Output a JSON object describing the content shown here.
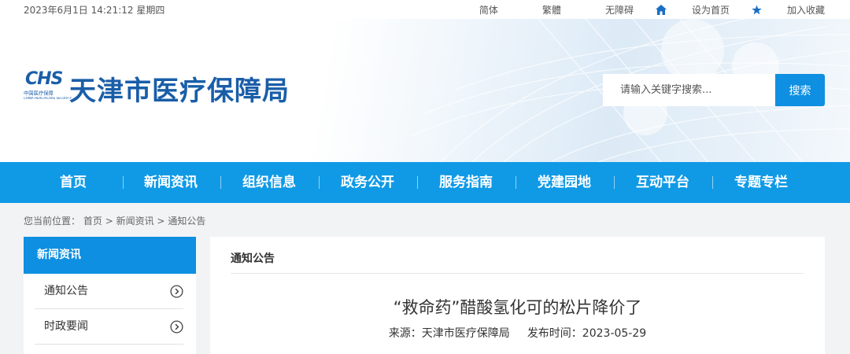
{
  "topbar": {
    "datetime": "2023年6月1日 14:21:12 星期四",
    "links": [
      {
        "label": "简体"
      },
      {
        "label": "繁體"
      },
      {
        "label": "无障碍"
      },
      {
        "label": "设为首页",
        "icon": "home-icon"
      },
      {
        "label": "加入收藏",
        "icon": "star-icon"
      }
    ]
  },
  "header": {
    "logo_abbr": "CHS",
    "logo_sub": "中国医疗保障",
    "logo_sub_en": "CHINA HEALTHCARE SECURITY",
    "site_title": "天津市医疗保障局"
  },
  "search": {
    "placeholder": "请输入关键字搜索...",
    "button_label": "搜索"
  },
  "nav": {
    "items": [
      {
        "label": "首页"
      },
      {
        "label": "新闻资讯"
      },
      {
        "label": "组织信息"
      },
      {
        "label": "政务公开"
      },
      {
        "label": "服务指南"
      },
      {
        "label": "党建园地"
      },
      {
        "label": "互动平台"
      },
      {
        "label": "专题专栏"
      }
    ]
  },
  "breadcrumb": {
    "prefix": "您当前位置：",
    "items": [
      "首页",
      "新闻资讯",
      "通知公告"
    ],
    "separator": ">"
  },
  "sidebar": {
    "heading": "新闻资讯",
    "items": [
      {
        "label": "通知公告"
      },
      {
        "label": "时政要闻"
      }
    ]
  },
  "content": {
    "section_title": "通知公告",
    "article_title": "“救命药”醋酸氢化可的松片降价了",
    "source": "来源：天津市医疗保障局",
    "publish_time": "发布时间：2023-05-29"
  },
  "colors": {
    "primary_blue": "#109ae6",
    "button_blue": "#0e8fe1",
    "logo_blue": "#1a5ea8"
  }
}
